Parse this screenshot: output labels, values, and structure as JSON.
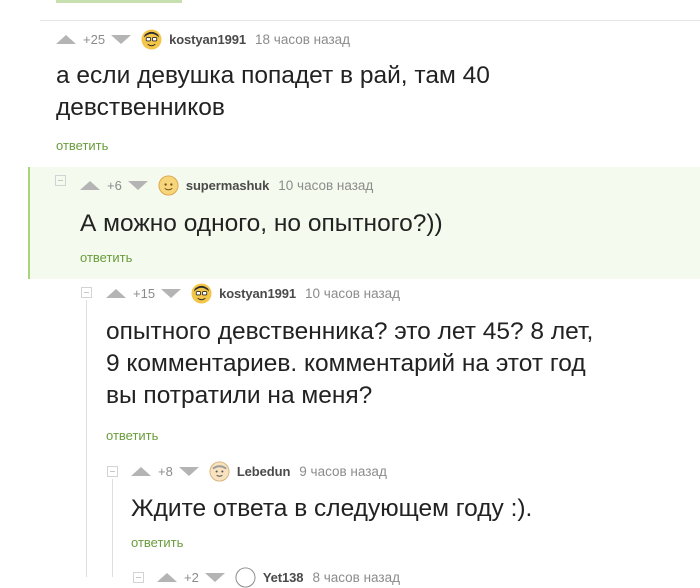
{
  "comments": [
    {
      "rating": "+25",
      "user": "kostyan1991",
      "time": "18 часов назад",
      "lines": [
        "а если девушка попадет в рай, там 40",
        "девственников"
      ],
      "reply": "ответить"
    },
    {
      "rating": "+6",
      "user": "supermashuk",
      "time": "10 часов назад",
      "lines": [
        "А можно одного, но опытного?))"
      ],
      "reply": "ответить"
    },
    {
      "rating": "+15",
      "user": "kostyan1991",
      "time": "10 часов назад",
      "lines": [
        "опытного девственника? это лет 45? 8 лет,",
        "9 комментариев. комментарий на этот год",
        "вы потратили на меня?"
      ],
      "reply": "ответить"
    },
    {
      "rating": "+8",
      "user": "Lebedun",
      "time": "9 часов назад",
      "lines": [
        "Ждите ответа в следующем году :)."
      ],
      "reply": "ответить"
    },
    {
      "rating": "+2",
      "user": "Yet138",
      "time": "8 часов назад"
    }
  ],
  "colors": {
    "highlight_bg": "#f4fbee",
    "highlight_border": "#a7d67a",
    "reply_link": "#6a9c3c"
  }
}
